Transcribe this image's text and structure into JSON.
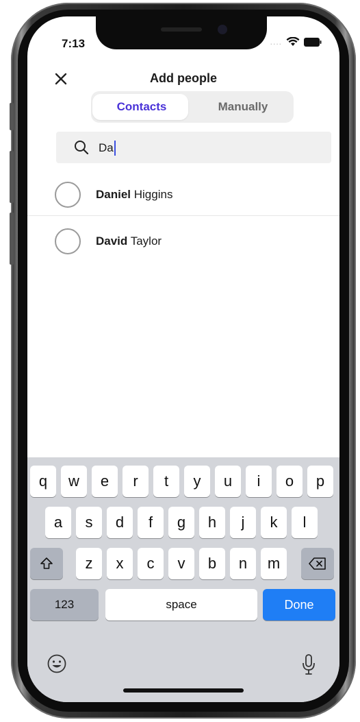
{
  "status": {
    "time": "7:13",
    "signal": "...."
  },
  "header": {
    "title": "Add people"
  },
  "tabs": [
    {
      "label": "Contacts",
      "active": true
    },
    {
      "label": "Manually",
      "active": false
    }
  ],
  "search": {
    "value": "Da"
  },
  "results": [
    {
      "match": "Daniel",
      "rest": " Higgins"
    },
    {
      "match": "David",
      "rest": " Taylor"
    }
  ],
  "keyboard": {
    "row1": [
      "q",
      "w",
      "e",
      "r",
      "t",
      "y",
      "u",
      "i",
      "o",
      "p"
    ],
    "row2": [
      "a",
      "s",
      "d",
      "f",
      "g",
      "h",
      "j",
      "k",
      "l"
    ],
    "row3": [
      "z",
      "x",
      "c",
      "v",
      "b",
      "n",
      "m"
    ],
    "numbers_label": "123",
    "space_label": "space",
    "done_label": "Done"
  },
  "colors": {
    "accent": "#4a33d8",
    "done": "#1f7ef5"
  }
}
